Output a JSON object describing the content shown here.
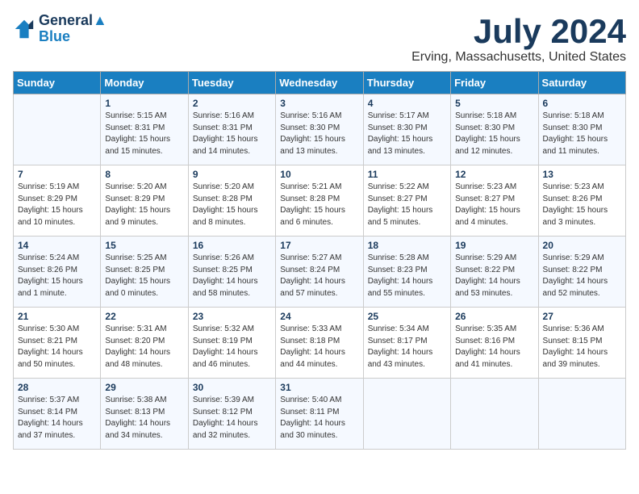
{
  "logo": {
    "line1": "General",
    "line2": "Blue"
  },
  "title": {
    "month": "July 2024",
    "location": "Erving, Massachusetts, United States"
  },
  "headers": [
    "Sunday",
    "Monday",
    "Tuesday",
    "Wednesday",
    "Thursday",
    "Friday",
    "Saturday"
  ],
  "weeks": [
    [
      {
        "day": "",
        "content": ""
      },
      {
        "day": "1",
        "content": "Sunrise: 5:15 AM\nSunset: 8:31 PM\nDaylight: 15 hours\nand 15 minutes."
      },
      {
        "day": "2",
        "content": "Sunrise: 5:16 AM\nSunset: 8:31 PM\nDaylight: 15 hours\nand 14 minutes."
      },
      {
        "day": "3",
        "content": "Sunrise: 5:16 AM\nSunset: 8:30 PM\nDaylight: 15 hours\nand 13 minutes."
      },
      {
        "day": "4",
        "content": "Sunrise: 5:17 AM\nSunset: 8:30 PM\nDaylight: 15 hours\nand 13 minutes."
      },
      {
        "day": "5",
        "content": "Sunrise: 5:18 AM\nSunset: 8:30 PM\nDaylight: 15 hours\nand 12 minutes."
      },
      {
        "day": "6",
        "content": "Sunrise: 5:18 AM\nSunset: 8:30 PM\nDaylight: 15 hours\nand 11 minutes."
      }
    ],
    [
      {
        "day": "7",
        "content": "Sunrise: 5:19 AM\nSunset: 8:29 PM\nDaylight: 15 hours\nand 10 minutes."
      },
      {
        "day": "8",
        "content": "Sunrise: 5:20 AM\nSunset: 8:29 PM\nDaylight: 15 hours\nand 9 minutes."
      },
      {
        "day": "9",
        "content": "Sunrise: 5:20 AM\nSunset: 8:28 PM\nDaylight: 15 hours\nand 8 minutes."
      },
      {
        "day": "10",
        "content": "Sunrise: 5:21 AM\nSunset: 8:28 PM\nDaylight: 15 hours\nand 6 minutes."
      },
      {
        "day": "11",
        "content": "Sunrise: 5:22 AM\nSunset: 8:27 PM\nDaylight: 15 hours\nand 5 minutes."
      },
      {
        "day": "12",
        "content": "Sunrise: 5:23 AM\nSunset: 8:27 PM\nDaylight: 15 hours\nand 4 minutes."
      },
      {
        "day": "13",
        "content": "Sunrise: 5:23 AM\nSunset: 8:26 PM\nDaylight: 15 hours\nand 3 minutes."
      }
    ],
    [
      {
        "day": "14",
        "content": "Sunrise: 5:24 AM\nSunset: 8:26 PM\nDaylight: 15 hours\nand 1 minute."
      },
      {
        "day": "15",
        "content": "Sunrise: 5:25 AM\nSunset: 8:25 PM\nDaylight: 15 hours\nand 0 minutes."
      },
      {
        "day": "16",
        "content": "Sunrise: 5:26 AM\nSunset: 8:25 PM\nDaylight: 14 hours\nand 58 minutes."
      },
      {
        "day": "17",
        "content": "Sunrise: 5:27 AM\nSunset: 8:24 PM\nDaylight: 14 hours\nand 57 minutes."
      },
      {
        "day": "18",
        "content": "Sunrise: 5:28 AM\nSunset: 8:23 PM\nDaylight: 14 hours\nand 55 minutes."
      },
      {
        "day": "19",
        "content": "Sunrise: 5:29 AM\nSunset: 8:22 PM\nDaylight: 14 hours\nand 53 minutes."
      },
      {
        "day": "20",
        "content": "Sunrise: 5:29 AM\nSunset: 8:22 PM\nDaylight: 14 hours\nand 52 minutes."
      }
    ],
    [
      {
        "day": "21",
        "content": "Sunrise: 5:30 AM\nSunset: 8:21 PM\nDaylight: 14 hours\nand 50 minutes."
      },
      {
        "day": "22",
        "content": "Sunrise: 5:31 AM\nSunset: 8:20 PM\nDaylight: 14 hours\nand 48 minutes."
      },
      {
        "day": "23",
        "content": "Sunrise: 5:32 AM\nSunset: 8:19 PM\nDaylight: 14 hours\nand 46 minutes."
      },
      {
        "day": "24",
        "content": "Sunrise: 5:33 AM\nSunset: 8:18 PM\nDaylight: 14 hours\nand 44 minutes."
      },
      {
        "day": "25",
        "content": "Sunrise: 5:34 AM\nSunset: 8:17 PM\nDaylight: 14 hours\nand 43 minutes."
      },
      {
        "day": "26",
        "content": "Sunrise: 5:35 AM\nSunset: 8:16 PM\nDaylight: 14 hours\nand 41 minutes."
      },
      {
        "day": "27",
        "content": "Sunrise: 5:36 AM\nSunset: 8:15 PM\nDaylight: 14 hours\nand 39 minutes."
      }
    ],
    [
      {
        "day": "28",
        "content": "Sunrise: 5:37 AM\nSunset: 8:14 PM\nDaylight: 14 hours\nand 37 minutes."
      },
      {
        "day": "29",
        "content": "Sunrise: 5:38 AM\nSunset: 8:13 PM\nDaylight: 14 hours\nand 34 minutes."
      },
      {
        "day": "30",
        "content": "Sunrise: 5:39 AM\nSunset: 8:12 PM\nDaylight: 14 hours\nand 32 minutes."
      },
      {
        "day": "31",
        "content": "Sunrise: 5:40 AM\nSunset: 8:11 PM\nDaylight: 14 hours\nand 30 minutes."
      },
      {
        "day": "",
        "content": ""
      },
      {
        "day": "",
        "content": ""
      },
      {
        "day": "",
        "content": ""
      }
    ]
  ]
}
